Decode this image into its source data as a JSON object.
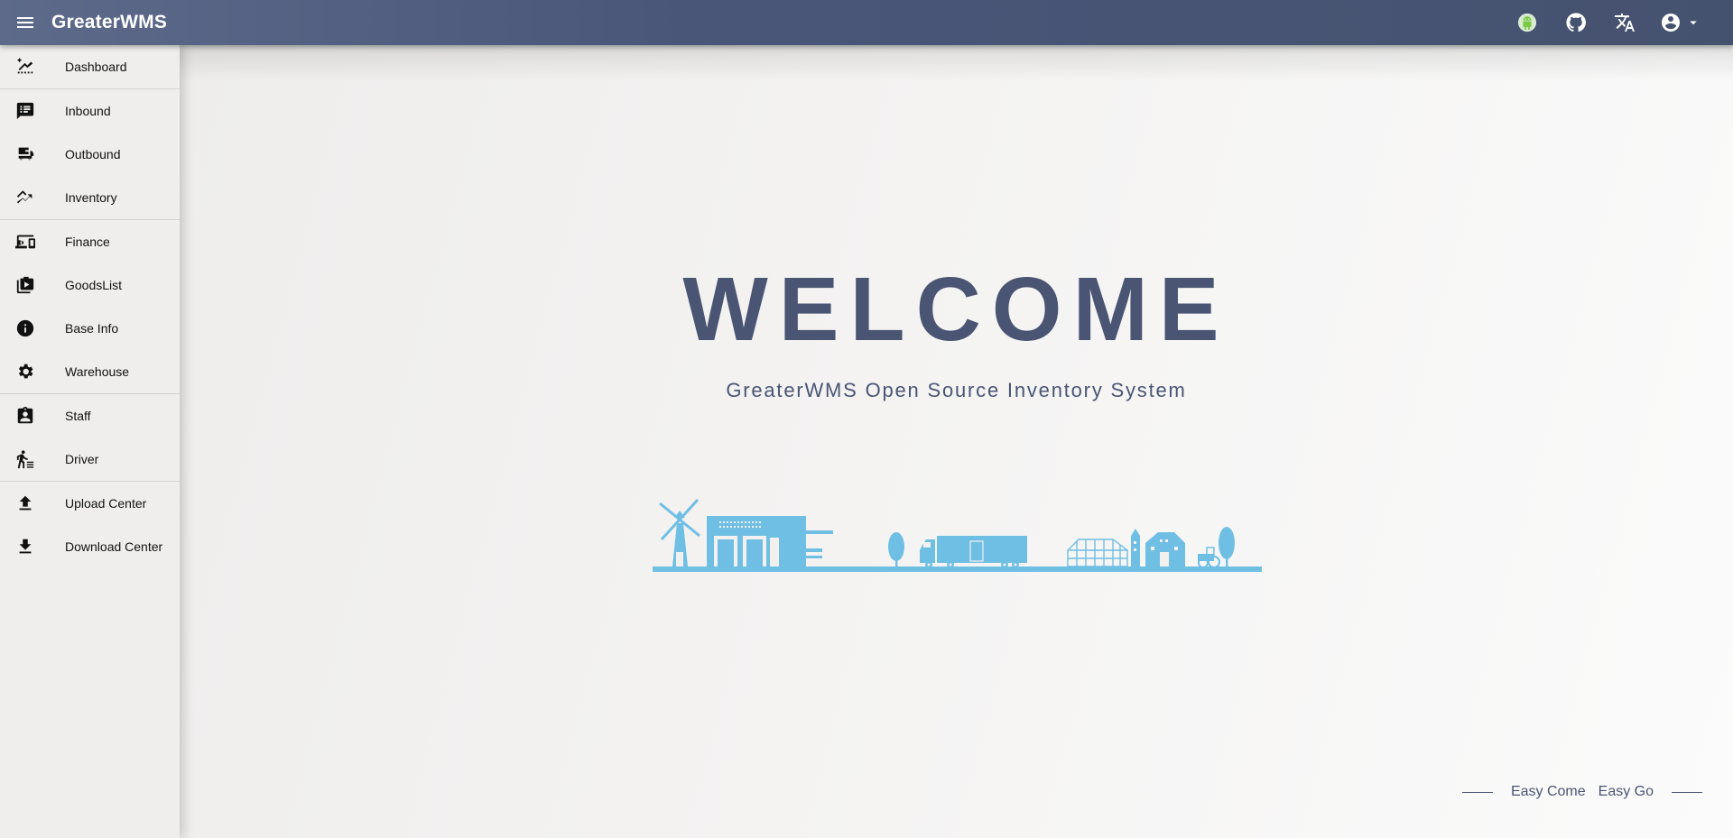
{
  "header": {
    "brand": "GreaterWMS",
    "icons": [
      "menu-icon",
      "android-icon",
      "github-icon",
      "translate-icon",
      "account-circle-icon",
      "caret-down-icon"
    ],
    "colors": {
      "bar": "#4a5678",
      "android": "#7ac943"
    }
  },
  "sidebar": {
    "items": [
      {
        "label": "Dashboard",
        "icon": "dashboard-chart-icon"
      },
      {
        "label": "Inbound",
        "icon": "inbound-list-icon"
      },
      {
        "label": "Outbound",
        "icon": "outbound-truck-icon"
      },
      {
        "label": "Inventory",
        "icon": "trend-icon"
      },
      {
        "label": "Finance",
        "icon": "devices-icon"
      },
      {
        "label": "GoodsList",
        "icon": "goods-bag-icon"
      },
      {
        "label": "Base Info",
        "icon": "info-icon"
      },
      {
        "label": "Warehouse",
        "icon": "gear-icon"
      },
      {
        "label": "Staff",
        "icon": "staff-badge-icon"
      },
      {
        "label": "Driver",
        "icon": "driver-icon"
      },
      {
        "label": "Upload Center",
        "icon": "upload-icon"
      },
      {
        "label": "Download Center",
        "icon": "download-icon"
      }
    ]
  },
  "main": {
    "title": "WELCOME",
    "subtitle": "GreaterWMS Open Source Inventory System",
    "slogan_left": "Easy Come",
    "slogan_right": "Easy Go",
    "colors": {
      "title": "#4a5574",
      "illustration": "#6fbfe4"
    }
  }
}
